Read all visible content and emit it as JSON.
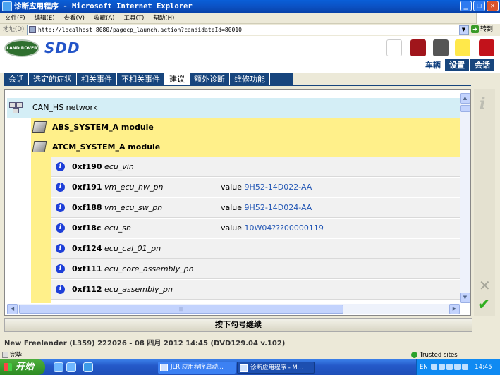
{
  "window": {
    "title": "诊断应用程序 - Microsoft Internet Explorer"
  },
  "menu": [
    "文件(F)",
    "编辑(E)",
    "查看(V)",
    "收藏(A)",
    "工具(T)",
    "帮助(H)"
  ],
  "address": {
    "label": "地址(D)",
    "url": "http://localhost:8080/pagecp_launch.action?candidateId=80010",
    "go_label": "转到"
  },
  "app": {
    "brand_text": "LAND ROVER",
    "sdd": "SDD"
  },
  "top_tabs": [
    {
      "label": "车辆",
      "active": true
    },
    {
      "label": "设置",
      "active": false
    },
    {
      "label": "会话",
      "active": false
    }
  ],
  "nav_tabs": [
    {
      "label": "会话",
      "active": false
    },
    {
      "label": "选定的症状",
      "active": false
    },
    {
      "label": "相关事件",
      "active": false
    },
    {
      "label": "不相关事件",
      "active": false
    },
    {
      "label": "建议",
      "active": true
    },
    {
      "label": "额外诊断",
      "active": false
    },
    {
      "label": "维修功能",
      "active": false
    }
  ],
  "tree": {
    "network": "CAN_HS network",
    "modules": [
      "ABS_SYSTEM_A module",
      "ATCM_SYSTEM_A module"
    ],
    "value_label": "value",
    "params": [
      {
        "id": "0xf190",
        "name": "ecu_vin",
        "value": ""
      },
      {
        "id": "0xf191",
        "name": "vm_ecu_hw_pn",
        "value": "9H52-14D022-AA"
      },
      {
        "id": "0xf188",
        "name": "vm_ecu_sw_pn",
        "value": "9H52-14D024-AA"
      },
      {
        "id": "0xf18c",
        "name": "ecu_sn",
        "value": "10W04???00000119"
      },
      {
        "id": "0xf124",
        "name": "ecu_cal_01_pn",
        "value": ""
      },
      {
        "id": "0xf111",
        "name": "ecu_core_assembly_pn",
        "value": ""
      },
      {
        "id": "0xf112",
        "name": "ecu_assembly_pn",
        "value": ""
      }
    ]
  },
  "continue_label": "按下勾号继续",
  "footer_info": "New Freelander (L359) 222026 - 08 四月  2012 14:45 (DVD129.04 v.102)",
  "status": {
    "text": "完毕",
    "zone": "Trusted sites"
  },
  "taskbar": {
    "start_label": "开始",
    "tasks": [
      {
        "label": "JLR 应用程序启动...",
        "active": false
      },
      {
        "label": "诊断应用程序 - M...",
        "active": true
      }
    ],
    "lang": "EN",
    "clock": "14:45"
  }
}
